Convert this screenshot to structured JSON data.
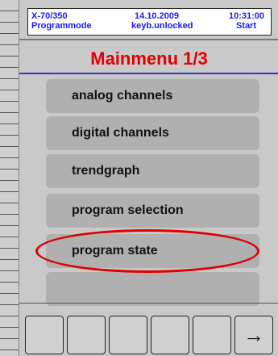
{
  "status": {
    "device": "X-70/350",
    "mode": "Programmode",
    "date": "14.10.2009",
    "keyboard": "keyb.unlocked",
    "time": "10:31:00",
    "action": "Start"
  },
  "title": "Mainmenu 1/3",
  "menu_items": [
    {
      "label": "analog channels"
    },
    {
      "label": "digital channels"
    },
    {
      "label": "trendgraph"
    },
    {
      "label": "program selection"
    },
    {
      "label": "program state"
    },
    {
      "label": ""
    }
  ],
  "highlighted_item": "program state",
  "softkeys": [
    "",
    "",
    "",
    "",
    "",
    "→"
  ],
  "colors": {
    "title": "#e20000",
    "status_text": "#1a1aff",
    "highlight": "#e00000",
    "panel": "#c9c9c9",
    "button": "#b0b0b0"
  }
}
